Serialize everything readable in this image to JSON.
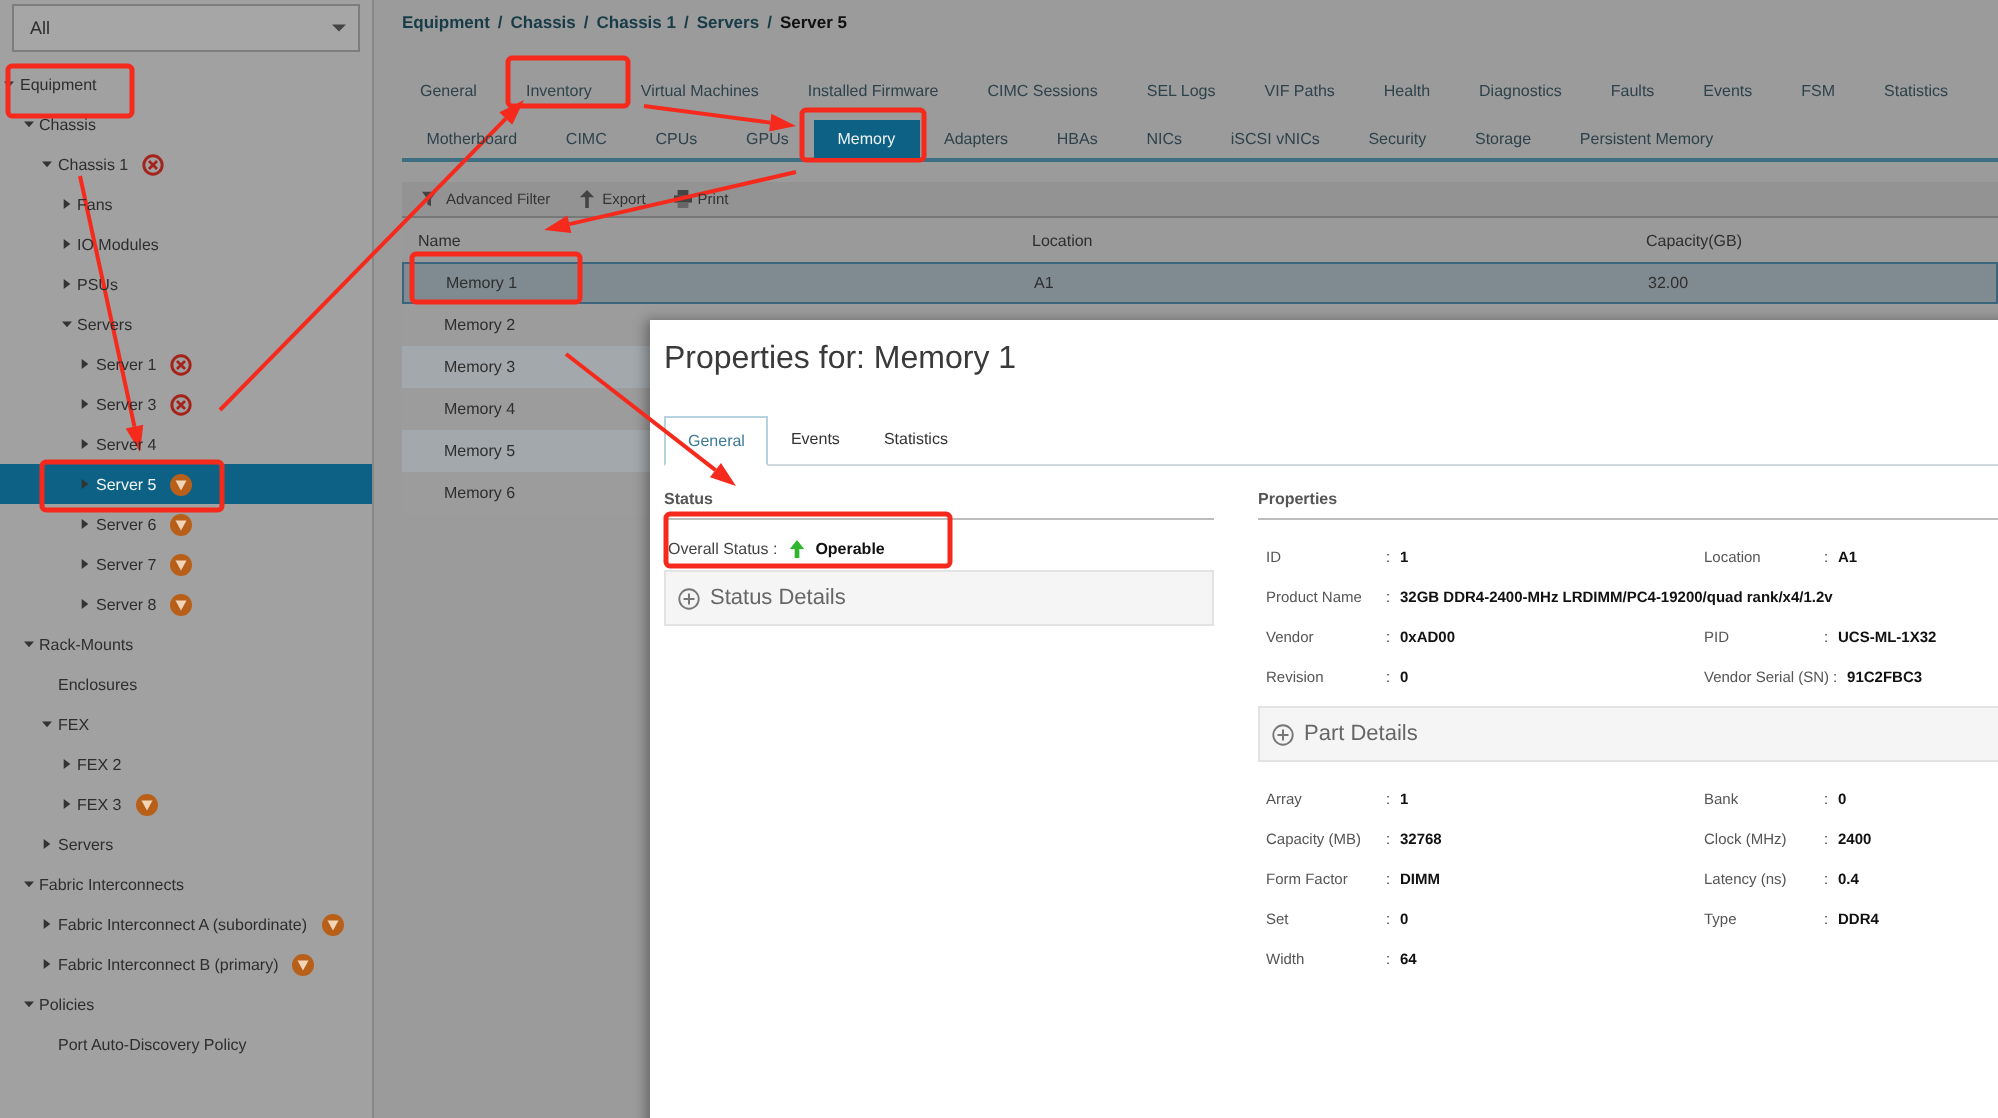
{
  "filter": {
    "value": "All"
  },
  "tree": [
    {
      "label": "Equipment",
      "kind": "plain",
      "expandable": true,
      "expanded": true,
      "selected": false,
      "children": [
        {
          "label": "Chassis",
          "kind": "plain",
          "expandable": true,
          "expanded": true,
          "selected": false,
          "children": [
            {
              "label": "Chassis 1",
              "kind": "critical",
              "expandable": true,
              "expanded": true,
              "selected": false,
              "children": [
                {
                  "label": "Fans",
                  "kind": "plain",
                  "expandable": true,
                  "expanded": false,
                  "selected": false
                },
                {
                  "label": "IO Modules",
                  "kind": "plain",
                  "expandable": true,
                  "expanded": false,
                  "selected": false
                },
                {
                  "label": "PSUs",
                  "kind": "plain",
                  "expandable": true,
                  "expanded": false,
                  "selected": false
                },
                {
                  "label": "Servers",
                  "kind": "plain",
                  "expandable": true,
                  "expanded": true,
                  "selected": false,
                  "children": [
                    {
                      "label": "Server 1",
                      "kind": "critical",
                      "expandable": true,
                      "expanded": false,
                      "selected": false
                    },
                    {
                      "label": "Server 3",
                      "kind": "critical",
                      "expandable": true,
                      "expanded": false,
                      "selected": false
                    },
                    {
                      "label": "Server 4",
                      "kind": "plain",
                      "expandable": true,
                      "expanded": false,
                      "selected": false
                    },
                    {
                      "label": "Server 5",
                      "kind": "major",
                      "expandable": true,
                      "expanded": false,
                      "selected": true
                    },
                    {
                      "label": "Server 6",
                      "kind": "major",
                      "expandable": true,
                      "expanded": false,
                      "selected": false
                    },
                    {
                      "label": "Server 7",
                      "kind": "major",
                      "expandable": true,
                      "expanded": false,
                      "selected": false
                    },
                    {
                      "label": "Server 8",
                      "kind": "major",
                      "expandable": true,
                      "expanded": false,
                      "selected": false
                    }
                  ]
                }
              ]
            }
          ]
        },
        {
          "label": "Rack-Mounts",
          "kind": "plain",
          "expandable": true,
          "expanded": true,
          "selected": false,
          "children": [
            {
              "label": "Enclosures",
              "kind": "plain",
              "expandable": false,
              "selected": false
            },
            {
              "label": "FEX",
              "kind": "plain",
              "expandable": true,
              "expanded": true,
              "selected": false,
              "children": [
                {
                  "label": "FEX 2",
                  "kind": "plain",
                  "expandable": true,
                  "expanded": false,
                  "selected": false
                },
                {
                  "label": "FEX 3",
                  "kind": "major",
                  "expandable": true,
                  "expanded": false,
                  "selected": false
                }
              ]
            },
            {
              "label": "Servers",
              "kind": "plain",
              "expandable": true,
              "expanded": false,
              "selected": false
            }
          ]
        },
        {
          "label": "Fabric Interconnects",
          "kind": "plain",
          "expandable": true,
          "expanded": true,
          "selected": false,
          "children": [
            {
              "label": "Fabric Interconnect A (subordinate)",
              "kind": "major",
              "expandable": true,
              "expanded": false,
              "selected": false
            },
            {
              "label": "Fabric Interconnect B (primary)",
              "kind": "major",
              "expandable": true,
              "expanded": false,
              "selected": false
            }
          ]
        },
        {
          "label": "Policies",
          "kind": "plain",
          "expandable": true,
          "expanded": true,
          "selected": false,
          "children": [
            {
              "label": "Port Auto-Discovery Policy",
              "kind": "plain",
              "expandable": false,
              "selected": false
            }
          ]
        }
      ]
    }
  ],
  "breadcrumb": [
    "Equipment",
    "/",
    "Chassis",
    "/",
    "Chassis 1",
    "/",
    "Servers",
    "/",
    "Server 5"
  ],
  "tabs": [
    {
      "label": "General",
      "selected": false
    },
    {
      "label": "Inventory",
      "selected": false
    },
    {
      "label": "Virtual Machines",
      "selected": false
    },
    {
      "label": "Installed Firmware",
      "selected": false
    },
    {
      "label": "CIMC Sessions",
      "selected": false
    },
    {
      "label": "SEL Logs",
      "selected": false
    },
    {
      "label": "VIF Paths",
      "selected": false
    },
    {
      "label": "Health",
      "selected": false
    },
    {
      "label": "Diagnostics",
      "selected": false
    },
    {
      "label": "Faults",
      "selected": false
    },
    {
      "label": "Events",
      "selected": false
    },
    {
      "label": "FSM",
      "selected": false
    },
    {
      "label": "Statistics",
      "selected": false
    }
  ],
  "subtabs": [
    {
      "label": "Motherboard",
      "selected": false
    },
    {
      "label": "CIMC",
      "selected": false
    },
    {
      "label": "CPUs",
      "selected": false
    },
    {
      "label": "GPUs",
      "selected": false
    },
    {
      "label": "Memory",
      "selected": true
    },
    {
      "label": "Adapters",
      "selected": false
    },
    {
      "label": "HBAs",
      "selected": false
    },
    {
      "label": "NICs",
      "selected": false
    },
    {
      "label": "iSCSI vNICs",
      "selected": false
    },
    {
      "label": "Security",
      "selected": false
    },
    {
      "label": "Storage",
      "selected": false
    },
    {
      "label": "Persistent Memory",
      "selected": false
    }
  ],
  "toolbar": [
    {
      "kind": "filter",
      "label": "Advanced Filter"
    },
    {
      "kind": "export",
      "label": "Export"
    },
    {
      "kind": "print",
      "label": "Print"
    }
  ],
  "table": {
    "columns": [
      "Name",
      "Location",
      "Capacity(GB)"
    ],
    "rows": [
      {
        "name": "Memory 1",
        "location": "A1",
        "capacity": "32.00",
        "selected": true
      },
      {
        "name": "Memory 2",
        "selected": false
      },
      {
        "name": "Memory 3",
        "selected": false
      },
      {
        "name": "Memory 4",
        "selected": false
      },
      {
        "name": "Memory 5",
        "selected": false
      },
      {
        "name": "Memory 6",
        "selected": false
      }
    ]
  },
  "dialog": {
    "title": "Properties for: Memory 1",
    "tabs": [
      {
        "label": "General",
        "selected": true
      },
      {
        "label": "Events",
        "selected": false
      },
      {
        "label": "Statistics",
        "selected": false
      }
    ],
    "status": {
      "heading": "Status",
      "label": "Overall Status :",
      "value": "Operable",
      "details": "Status Details"
    },
    "properties": {
      "heading": "Properties",
      "rows": [
        [
          {
            "label": "ID",
            "sep": ":",
            "value": "1"
          },
          {
            "label": "Location",
            "sep": ":",
            "value": "A1"
          }
        ],
        [
          {
            "label": "Product Name",
            "sep": ":",
            "value": "32GB DDR4-2400-MHz LRDIMM/PC4-19200/quad rank/x4/1.2v"
          }
        ],
        [
          {
            "label": "Vendor",
            "sep": ":",
            "value": "0xAD00"
          },
          {
            "label": "PID",
            "sep": ":",
            "value": "UCS-ML-1X32"
          }
        ],
        [
          {
            "label": "Revision",
            "sep": ":",
            "value": "0"
          },
          {
            "label": "Vendor Serial (SN)",
            "sep": ":",
            "value": "91C2FBC3"
          }
        ]
      ],
      "details": "Part Details",
      "rows2": [
        [
          {
            "label": "Array",
            "sep": ":",
            "value": "1"
          },
          {
            "label": "Bank",
            "sep": ":",
            "value": "0"
          }
        ],
        [
          {
            "label": "Capacity (MB)",
            "sep": ":",
            "value": "32768"
          },
          {
            "label": "Clock (MHz)",
            "sep": ":",
            "value": "2400"
          }
        ],
        [
          {
            "label": "Form Factor",
            "sep": ":",
            "value": "DIMM"
          },
          {
            "label": "Latency (ns)",
            "sep": ":",
            "value": "0.4"
          }
        ],
        [
          {
            "label": "Set",
            "sep": ":",
            "value": "0"
          },
          {
            "label": "Type",
            "sep": ":",
            "value": "DDR4"
          }
        ],
        [
          {
            "label": "Width",
            "sep": ":",
            "value": "64"
          }
        ]
      ]
    }
  }
}
